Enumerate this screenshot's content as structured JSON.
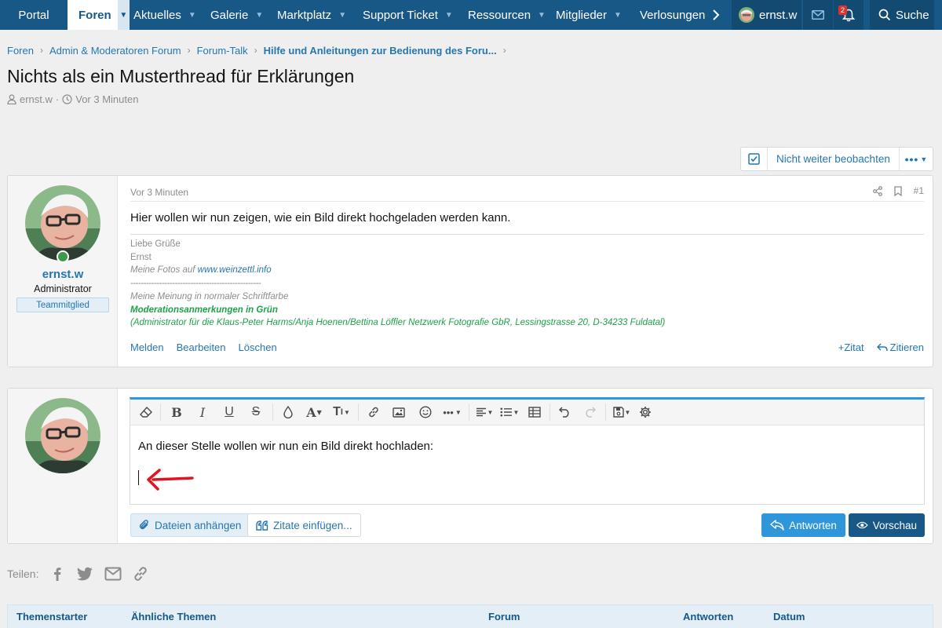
{
  "nav": {
    "tabs": [
      {
        "label": "Portal",
        "caret": false
      },
      {
        "label": "Foren",
        "caret": true,
        "active": true
      },
      {
        "label": "Aktuelles",
        "caret": true
      },
      {
        "label": "Galerie",
        "caret": true
      },
      {
        "label": "Marktplatz",
        "caret": true
      },
      {
        "label": "Support Ticket",
        "caret": true
      },
      {
        "label": "Ressourcen",
        "caret": true
      },
      {
        "label": "Mitglieder",
        "caret": true
      },
      {
        "label": "Verlosungen",
        "caret": false
      }
    ],
    "username": "ernst.w",
    "alerts_count": "2",
    "search_label": "Suche"
  },
  "breadcrumb": [
    "Foren",
    "Admin & Moderatoren Forum",
    "Forum-Talk",
    "Hilfe und Anleitungen zur Bedienung des Foru..."
  ],
  "thread": {
    "title": "Nichts als ein Musterthread für Erklärungen",
    "author": "ernst.w",
    "time": "Vor 3 Minuten"
  },
  "watch": {
    "label": "Nicht weiter beobachten"
  },
  "post": {
    "date": "Vor 3 Minuten",
    "number": "#1",
    "body": "Hier wollen wir nun zeigen, wie ein Bild direkt hochgeladen werden kann.",
    "user": {
      "name": "ernst.w",
      "title": "Administrator",
      "banner": "Teammitglied"
    },
    "signature": {
      "line1": "Liebe Grüße",
      "line2": "Ernst",
      "line3_prefix": "Meine Fotos auf ",
      "line3_link": "www.weinzettl.info",
      "line4": "--------------------------------------------------",
      "line5": "Meine Meinung in normaler Schriftfarbe",
      "line6": "Moderationsanmerkungen in Grün",
      "line7": "(Administrator für die Klaus-Peter Harms/Anja Hoenen/Bettina Löffler Netzwerk Fotografie GbR, Lessingstrasse 20, D-34233 Fuldatal)"
    },
    "actions": {
      "report": "Melden",
      "edit": "Bearbeiten",
      "delete": "Löschen",
      "quote": "Zitat",
      "reply_quote": "Zitieren"
    }
  },
  "reply": {
    "editor_text": "An dieser Stelle wollen wir nun ein Bild direkt hochladen:",
    "attach": "Dateien anhängen",
    "insert_quotes": "Zitate einfügen...",
    "submit": "Antworten",
    "preview": "Vorschau"
  },
  "share": {
    "label": "Teilen:"
  },
  "similar_table": {
    "headers": [
      "Themenstarter",
      "Ähnliche Themen",
      "Forum",
      "Antworten",
      "Datum"
    ]
  },
  "colors": {
    "nav": "#185886",
    "link": "#2577b1",
    "accent": "#2e96d9",
    "moderation_green": "#1fa14a",
    "arrow_red": "#e0141e"
  }
}
